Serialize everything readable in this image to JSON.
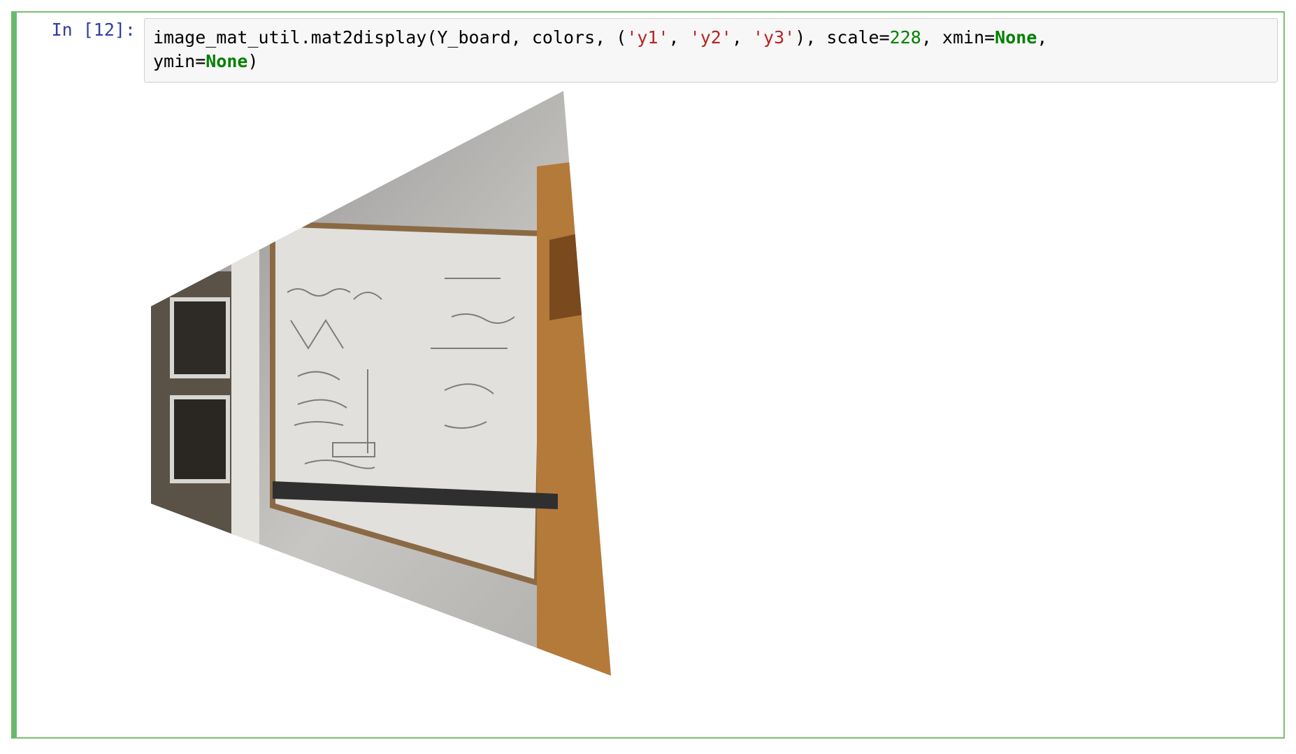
{
  "cell": {
    "prompt": "In [12]:",
    "code": {
      "line1": [
        {
          "t": "image_mat_util.mat2display(Y_board, colors, (",
          "c": "plain"
        },
        {
          "t": "'y1'",
          "c": "str"
        },
        {
          "t": ", ",
          "c": "plain"
        },
        {
          "t": "'y2'",
          "c": "str"
        },
        {
          "t": ", ",
          "c": "plain"
        },
        {
          "t": "'y3'",
          "c": "str"
        },
        {
          "t": "), scale=",
          "c": "plain"
        },
        {
          "t": "228",
          "c": "num"
        },
        {
          "t": ", xmin=",
          "c": "plain"
        },
        {
          "t": "None",
          "c": "kw"
        },
        {
          "t": ",",
          "c": "plain"
        }
      ],
      "line2": [
        {
          "t": "ymin=",
          "c": "plain"
        },
        {
          "t": "None",
          "c": "kw"
        },
        {
          "t": ")",
          "c": "plain"
        }
      ]
    }
  },
  "output": {
    "image_subject": "perspective-warped photo of a whiteboard with math writing",
    "colors": {
      "wall": "#c9c7c4",
      "board": "#e6e4e0",
      "wood": "#b47a3a",
      "frame": "#8a6a45"
    }
  }
}
